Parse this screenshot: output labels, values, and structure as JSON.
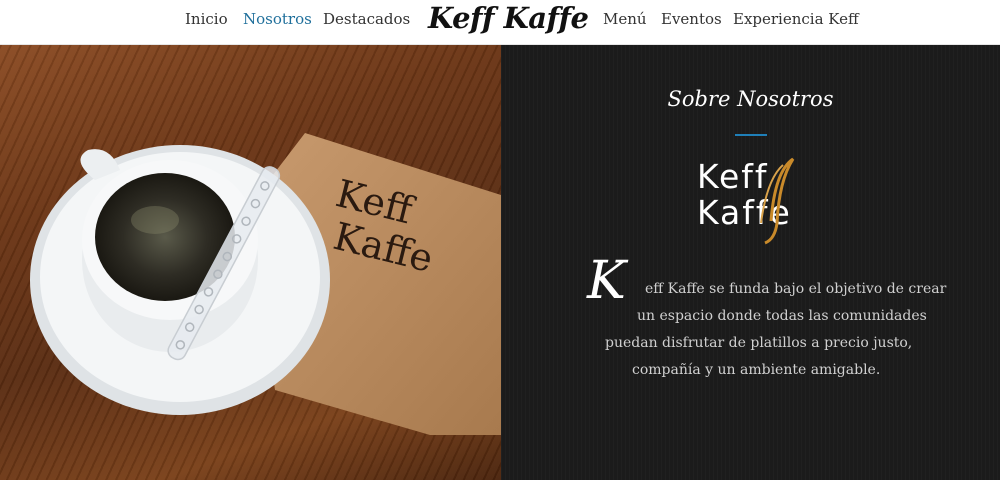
{
  "nav": {
    "items_left": [
      "Inicio",
      "Nosotros",
      "Destacados"
    ],
    "logo": "Keff Kaffe",
    "items_right": [
      "Menú",
      "Eventos",
      "Experiencia Keff"
    ],
    "active": "Nosotros"
  },
  "photo": {
    "napkin_logo_line1": "Keff",
    "napkin_logo_line2": "Kaffe"
  },
  "about": {
    "title": "Sobre Nosotros",
    "logo_line1": "Keff",
    "logo_line2": "Kaffe",
    "drop_cap": "K",
    "lines": [
      "eff Kaffe se funda bajo el objetivo de crear",
      "un espacio donde todas las comunidades",
      "puedan disfrutar de platillos a precio justo,",
      "compañía y un ambiente amigable."
    ]
  },
  "colors": {
    "accent": "#1f7fb8",
    "panel_bg": "#1b1b1b",
    "logo_gold": "#c98a2a"
  }
}
